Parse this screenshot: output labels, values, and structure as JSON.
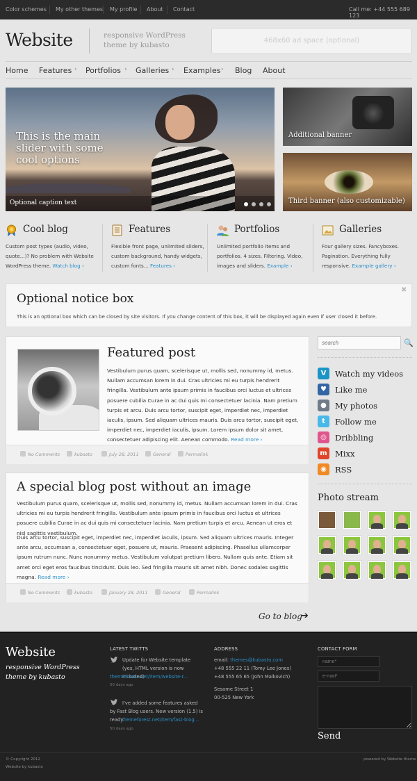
{
  "topbar": {
    "links": [
      "Color schemes",
      "My other themes",
      "My profile",
      "About",
      "Contact"
    ],
    "call": "Call me: +44 555 689 123"
  },
  "header": {
    "logo": "Website",
    "tagline": "responsive WordPress theme by kubasto",
    "ad_space": "468x60 ad space (optional)"
  },
  "nav": {
    "items": [
      {
        "label": "Home",
        "chevron": false
      },
      {
        "label": "Features",
        "chevron": true
      },
      {
        "label": "Portfolios",
        "chevron": true
      },
      {
        "label": "Galleries",
        "chevron": true
      },
      {
        "label": "Examples",
        "chevron": true
      },
      {
        "label": "Blog",
        "chevron": false
      },
      {
        "label": "About",
        "chevron": false
      }
    ],
    "chevron_glyph": "›"
  },
  "slider": {
    "main_caption": "This is the main slider with some cool options",
    "optional_caption": "Optional caption text",
    "dots": 4,
    "active_dot": 0
  },
  "banners": {
    "additional": "Additional banner",
    "third": "Third banner (also customizable)"
  },
  "features": [
    {
      "icon": "ribbon-icon",
      "icon_color": "#e6a817",
      "title": "Cool blog",
      "desc": "Custom post types (audio, video, quote...)? No problem with Website WordPress theme.",
      "link": "Watch blog ›"
    },
    {
      "icon": "document-icon",
      "icon_color": "#c0823a",
      "title": "Features",
      "desc": "Flexible front page, unlimited sliders, custom background, handy widgets, custom fonts...",
      "link": "Features ›"
    },
    {
      "icon": "users-icon",
      "icon_color": "#3a8fd0",
      "title": "Portfolios",
      "desc": "Unlimited portfolio items and portfolios. 4 sizes. Filtering. Video, images and sliders.",
      "link": "Example ›"
    },
    {
      "icon": "gallery-icon",
      "icon_color": "#d4a640",
      "title": "Galleries",
      "desc": "Four gallery sizes. Fancyboxes. Pagination. Everything fully responsive.",
      "link": "Example gallery ›"
    }
  ],
  "notice": {
    "title": "Optional notice box",
    "text": "This is an optional box which can be closed by site visitors. If you change content of this box, it will be displayed again even if user closed it before.",
    "close": "✖"
  },
  "posts": [
    {
      "title": "Featured post",
      "paragraphs": [
        "Vestibulum purus quam, scelerisque ut, mollis sed, nonummy id, metus. Nullam accumsan lorem in dui. Cras ultricies mi eu turpis hendrerit fringilla. Vestibulum ante ipsum primis in faucibus orci luctus et ultrices posuere cubilia Curae in ac dui quis mi consectetuer lacinia. Nam pretium turpis et arcu. Duis arcu tortor, suscipit eget, imperdiet nec, imperdiet iaculis, ipsum. Sed aliquam ultrices mauris. Duis arcu tortor, suscipit eget, imperdiet nec, imperdiet iaculis, ipsum. Lorem ipsum dolor sit amet, consectetuer adipiscing elit. Aenean commodo."
      ],
      "more": "Read more ›",
      "meta": [
        "No Comments",
        "kubasto",
        "July 28, 2011",
        "General",
        "Permalink"
      ]
    },
    {
      "title": "A special blog post without an image",
      "paragraphs": [
        "Vestibulum purus quam, scelerisque ut, mollis sed, nonummy id, metus. Nullam accumsan lorem in dui. Cras ultricies mi eu turpis hendrerit fringilla. Vestibulum ante ipsum primis in faucibus orci luctus et ultrices posuere cubilia Curae in ac dui quis mi consectetuer lacinia. Nam pretium turpis et arcu. Aenean ut eros et nisl sagittis vestibulum.",
        "Duis arcu tortor, suscipit eget, imperdiet nec, imperdiet iaculis, ipsum. Sed aliquam ultrices mauris. Integer ante arcu, accumsan a, consectetuer eget, posuere ut, mauris. Praesent adipiscing. Phasellus ullamcorper ipsum rutrum nunc. Nunc nonummy metus. Vestibulum volutpat pretium libero. Nullam quis ante. Etiam sit amet orci eget eros faucibus tincidunt. Duis leo. Sed fringilla mauris sit amet nibh. Donec sodales sagittis magna."
      ],
      "more": "Read more ›",
      "meta": [
        "No Comments",
        "kubasto",
        "January 28, 2011",
        "General",
        "Permalink"
      ]
    }
  ],
  "goto_blog": "Go to blog",
  "goto_arrow": "➔",
  "sidebar": {
    "search_placeholder": "search",
    "search_icon": "🔍",
    "social": [
      {
        "icon": "vimeo-icon",
        "glyph": "V",
        "color": "#1a95c7",
        "label": "Watch my videos"
      },
      {
        "icon": "heart-icon",
        "glyph": "♥",
        "color": "#3466a3",
        "label": "Like me"
      },
      {
        "icon": "flickr-icon",
        "glyph": "●",
        "color": "#6f7b88",
        "label": "My photos"
      },
      {
        "icon": "twitter-icon",
        "glyph": "t",
        "color": "#48b8e8",
        "label": "Follow me"
      },
      {
        "icon": "dribbble-icon",
        "glyph": "◎",
        "color": "#e0558e",
        "label": "Dribbling"
      },
      {
        "icon": "mixx-icon",
        "glyph": "m",
        "color": "#e0452b",
        "label": "Mixx"
      },
      {
        "icon": "rss-icon",
        "glyph": "◉",
        "color": "#f08a24",
        "label": "RSS"
      }
    ],
    "photo_stream_title": "Photo stream",
    "photo_count": 12
  },
  "footer": {
    "logo": "Website",
    "tagline": "responsive WordPress theme by kubasto",
    "twitts_heading": "LATEST TWITTS",
    "twitts": [
      {
        "text": "Update for Website template (yes, HTML version is now included):",
        "link": "themeforest.net/item/website-r...",
        "ago": "50 days ago"
      },
      {
        "text": "I've added some features asked by Fast Blog users. New version (1.5) is ready:",
        "link": "themeforest.net/item/fast-blog...",
        "ago": "50 days ago"
      }
    ],
    "address_heading": "ADDRESS",
    "email_label": "email:",
    "email": "themes@kubasto.com",
    "phone1": "+48 555 22 11 (Tomy Lee Jones)",
    "phone2": "+48 555 65 65 (John Malkovich)",
    "street": "Sesame Street 1",
    "city": "00-525 New York",
    "contact_heading": "CONTACT FORM",
    "name_placeholder": "name*",
    "email_placeholder": "e-mail*",
    "send": "Send",
    "copyright": "© Copyright 2012",
    "byline": "Website by kubasto",
    "powered": "powered by Website theme"
  },
  "colors": {
    "link": "#2a8fc9",
    "topbar": "#2b2b2b",
    "footer": "#222222",
    "page": "#e6e6e6"
  }
}
